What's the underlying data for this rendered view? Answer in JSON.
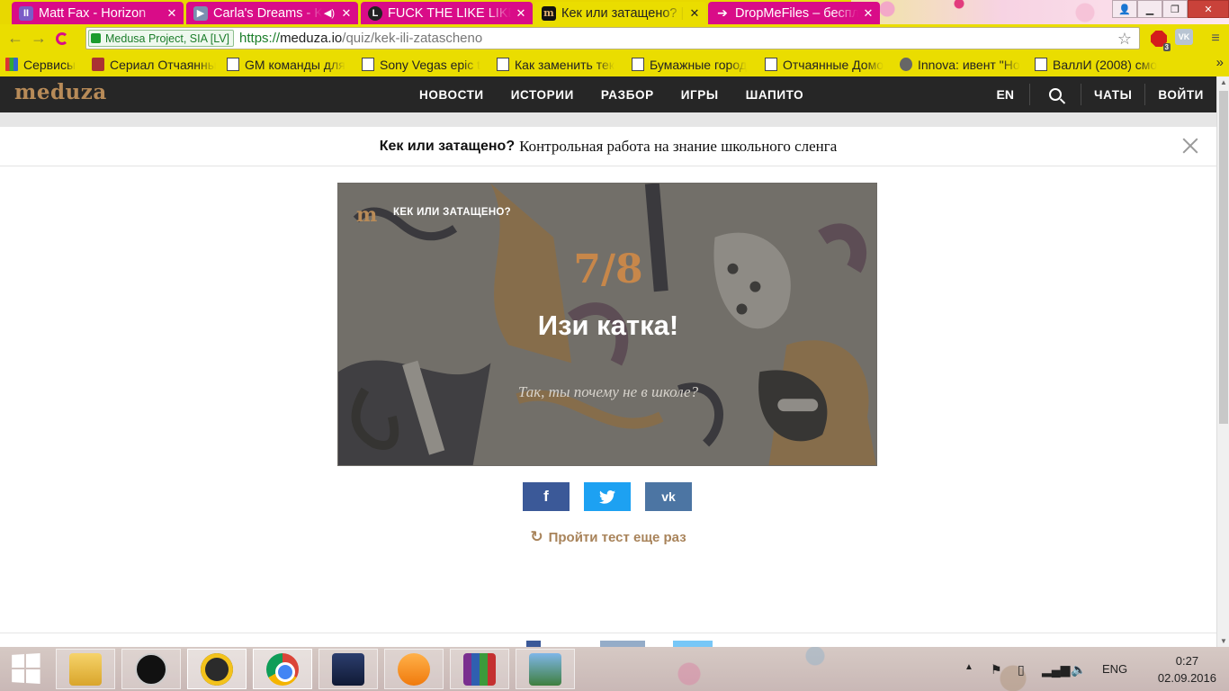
{
  "browser": {
    "tabs": [
      {
        "title": "Matt Fax - Horizon",
        "icon": "pause-icon",
        "icon_color": "#7a5cc7",
        "active": false
      },
      {
        "title": "Carla's Dreams - K",
        "icon": "play-icon",
        "icon_color": "#7a8fb0",
        "active": false,
        "audio": true
      },
      {
        "title": "FUCK THE LIKE LIKE",
        "icon": "L-icon",
        "icon_color": "#222222",
        "active": false
      },
      {
        "title": "Кек или затащено? |",
        "icon": "meduza-m-icon",
        "icon_color": "#111111",
        "active": true
      },
      {
        "title": "DropMeFiles – беспл",
        "icon": "arrow-right-icon",
        "icon_color": "#ffffff",
        "active": false
      }
    ],
    "tab_close_glyph": "✕",
    "toolbar": {
      "back_glyph": "←",
      "forward_glyph": "→",
      "reload_glyph": "C",
      "security_label": "Medusa Project, SIA [LV]",
      "url_scheme": "https://",
      "url_host": "meduza.io",
      "url_path": "/quiz/kek-ili-zatascheno",
      "star_glyph": "☆",
      "adblock_badge": "3",
      "vk_ext_label": "VK",
      "menu_glyph": "≡"
    },
    "bookmarks": [
      {
        "label": "Сервисы",
        "icon": "grid-icon"
      },
      {
        "label": "Сериал Отчаянные",
        "icon": "image-icon"
      },
      {
        "label": "GM команды для",
        "icon": "page-icon"
      },
      {
        "label": "Sony Vegas epic t",
        "icon": "page-icon"
      },
      {
        "label": "Как заменить тек",
        "icon": "page-icon"
      },
      {
        "label": "Бумажные город",
        "icon": "page-icon"
      },
      {
        "label": "Отчаянные Домо",
        "icon": "page-icon"
      },
      {
        "label": "Innova: ивент \"Но",
        "icon": "avatar-icon"
      },
      {
        "label": "ВаллИ (2008) смо",
        "icon": "page-icon"
      }
    ],
    "bookmarks_more_glyph": "»"
  },
  "site": {
    "logo": "meduza",
    "nav": [
      "НОВОСТИ",
      "ИСТОРИИ",
      "РАЗБОР",
      "ИГРЫ",
      "ШАПИТО"
    ],
    "lang": "EN",
    "chats": "ЧАТЫ",
    "login": "ВОЙТИ"
  },
  "quiz": {
    "title_strong": "Кек или затащено?",
    "title_rest": "Контрольная работа на знание школьного сленга",
    "card": {
      "logo_letter": "m",
      "label": "КЕК ИЛИ ЗАТАЩЕНО?",
      "score": "7/8",
      "result_title": "Изи катка!",
      "result_subtitle": "Так, ты почему не в школе?"
    },
    "share": {
      "facebook_glyph": "f",
      "twitter_glyph": "🐦",
      "vk_glyph": "vk"
    },
    "retry_label": "Пройти тест еще раз",
    "retry_glyph": "↻"
  },
  "taskbar": {
    "apps": [
      "file-explorer",
      "ble-app",
      "aimp-player",
      "chrome",
      "lineage-2",
      "media-player",
      "winrar",
      "photo-viewer"
    ],
    "lang": "ENG",
    "time": "0:27",
    "date": "02.09.2016"
  }
}
